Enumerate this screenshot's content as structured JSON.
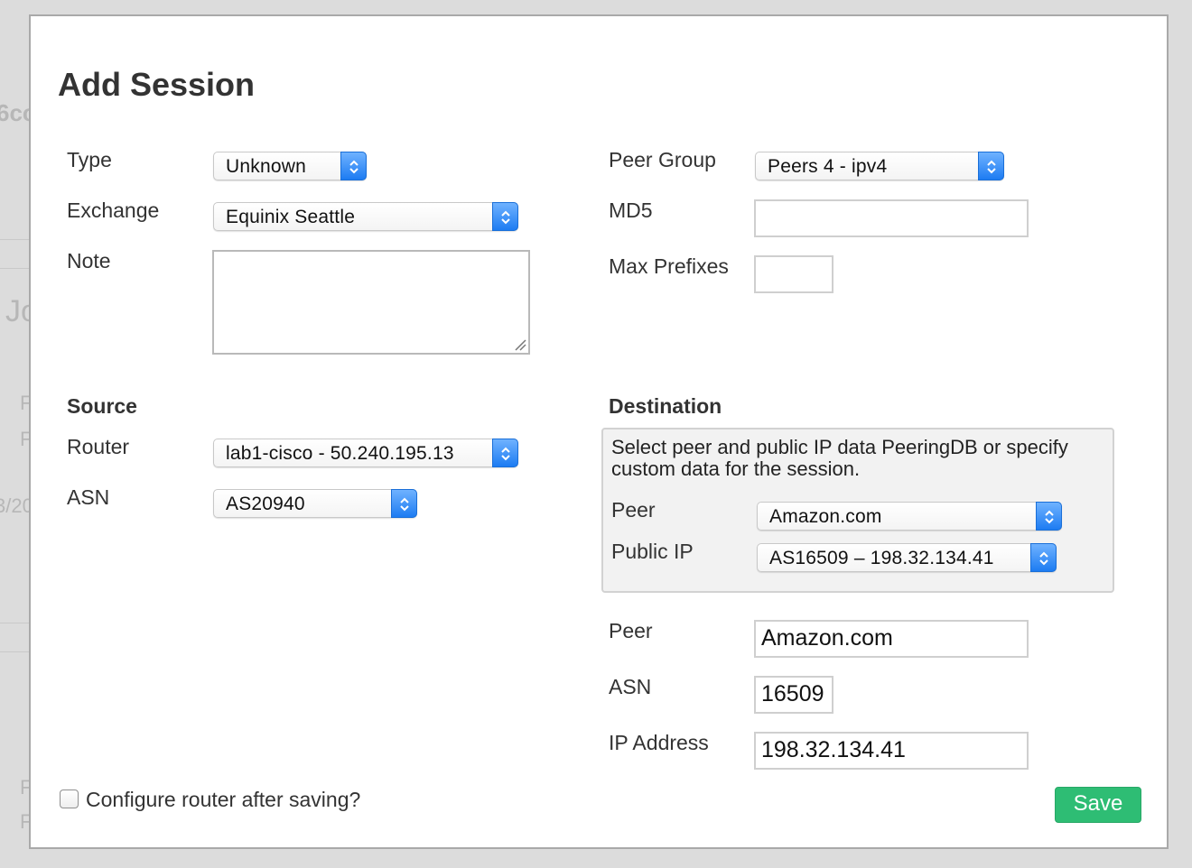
{
  "background": {
    "fragments": [
      "6cc",
      "Jo",
      "F",
      "F",
      "3/20",
      "F",
      "F"
    ]
  },
  "modal": {
    "title": "Add Session",
    "left": {
      "type": {
        "label": "Type",
        "value": "Unknown"
      },
      "exchange": {
        "label": "Exchange",
        "value": "Equinix Seattle"
      },
      "note": {
        "label": "Note",
        "value": ""
      }
    },
    "right": {
      "peer_group": {
        "label": "Peer Group",
        "value": "Peers 4 - ipv4"
      },
      "md5": {
        "label": "MD5",
        "value": ""
      },
      "max_prefixes": {
        "label": "Max Prefixes",
        "value": ""
      }
    },
    "source": {
      "heading": "Source",
      "router": {
        "label": "Router",
        "value": "lab1-cisco - 50.240.195.13"
      },
      "asn": {
        "label": "ASN",
        "value": "AS20940"
      }
    },
    "destination": {
      "heading": "Destination",
      "help": "Select peer and public IP data PeeringDB or specify custom data for the session.",
      "peer_select": {
        "label": "Peer",
        "value": "Amazon.com"
      },
      "public_ip": {
        "label": "Public IP",
        "value": "AS16509 – 198.32.134.41"
      },
      "peer": {
        "label": "Peer",
        "value": "Amazon.com"
      },
      "asn": {
        "label": "ASN",
        "value": "16509"
      },
      "ip_address": {
        "label": "IP Address",
        "value": "198.32.134.41"
      }
    },
    "configure_checkbox": {
      "label": "Configure router after saving?",
      "checked": false
    },
    "save_label": "Save"
  },
  "colors": {
    "accent_select": "#1d7cf2",
    "save_button": "#2ebd74"
  }
}
